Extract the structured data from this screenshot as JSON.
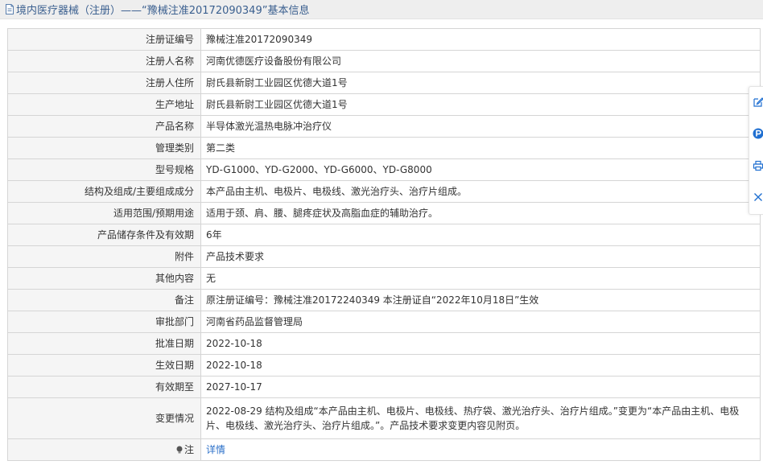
{
  "header": {
    "title": "境内医疗器械（注册）——“豫械注准20172090349”基本信息",
    "icon": "document-icon"
  },
  "table": {
    "rows": [
      {
        "label": "注册证编号",
        "value": "豫械注准20172090349"
      },
      {
        "label": "注册人名称",
        "value": "河南优德医疗设备股份有限公司"
      },
      {
        "label": "注册人住所",
        "value": "尉氏县新尉工业园区优德大道1号"
      },
      {
        "label": "生产地址",
        "value": "尉氏县新尉工业园区优德大道1号"
      },
      {
        "label": "产品名称",
        "value": "半导体激光温热电脉冲治疗仪"
      },
      {
        "label": "管理类别",
        "value": "第二类"
      },
      {
        "label": "型号规格",
        "value": "YD-G1000、YD-G2000、YD-G6000、YD-G8000"
      },
      {
        "label": "结构及组成/主要组成成分",
        "value": "本产品由主机、电极片、电极线、激光治疗头、治疗片组成。"
      },
      {
        "label": "适用范围/预期用途",
        "value": "适用于颈、肩、腰、腿疼症状及高脂血症的辅助治疗。"
      },
      {
        "label": "产品储存条件及有效期",
        "value": "6年"
      },
      {
        "label": "附件",
        "value": "产品技术要求"
      },
      {
        "label": "其他内容",
        "value": "无"
      },
      {
        "label": "备注",
        "value": "原注册证编号：豫械注准20172240349 本注册证自“2022年10月18日”生效"
      },
      {
        "label": "审批部门",
        "value": "河南省药品监督管理局"
      },
      {
        "label": "批准日期",
        "value": "2022-10-18"
      },
      {
        "label": "生效日期",
        "value": "2022-10-18"
      },
      {
        "label": "有效期至",
        "value": "2027-10-17"
      },
      {
        "label": "变更情况",
        "value": "2022-08-29 结构及组成“本产品由主机、电极片、电极线、热疗袋、激光治疗头、治疗片组成。”变更为“本产品由主机、电极片、电极线、激光治疗头、治疗片组成。”。产品技术要求变更内容见附页。"
      }
    ],
    "note": {
      "label": "注",
      "link_text": "详情"
    }
  },
  "side_toolbar": {
    "icons": [
      "edit-icon",
      "parking-icon",
      "print-icon",
      "close-icon"
    ]
  },
  "colors": {
    "header_bg": "#eeeeee",
    "title_text": "#3a5f8f",
    "label_bg": "#f5f5f5",
    "border": "#d5d5d5",
    "link": "#2a6fc9",
    "accent_blue": "#1f6fd1"
  }
}
